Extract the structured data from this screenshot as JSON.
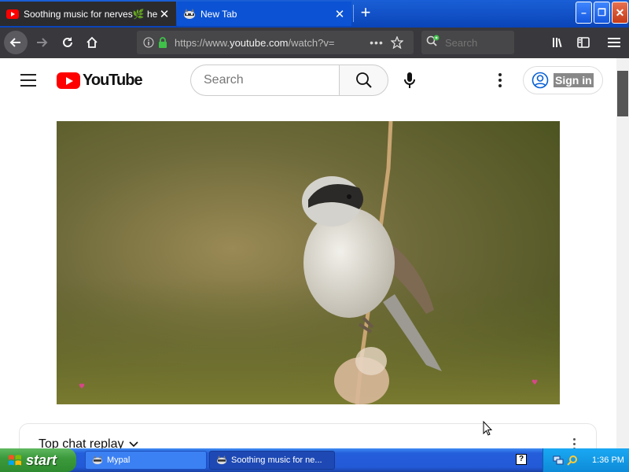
{
  "browser": {
    "tabs": [
      {
        "title": "Soothing music for nerves🌿 healing music for the heart and blood vessels, relaxation, music for soul",
        "favicon": "youtube-icon",
        "active": true
      },
      {
        "title": "New Tab",
        "favicon": "raccoon-icon",
        "active": false
      }
    ],
    "window_buttons": {
      "minimize": "–",
      "restore": "❐",
      "close": "✕"
    },
    "url_prefix": "https://www.",
    "url_domain": "youtube.com",
    "url_path": "/watch?v=",
    "search_placeholder": "Search"
  },
  "youtube": {
    "logo_text": "YouTube",
    "search_placeholder": "Search",
    "sign_in_label": "Sign in",
    "chat_title": "Top chat replay"
  },
  "taskbar": {
    "start_label": "start",
    "tasks": [
      {
        "label": "Mypal"
      },
      {
        "label": "Soothing music for ne..."
      }
    ],
    "help_label": "?",
    "clock": "1:36 PM"
  },
  "colors": {
    "xp_blue": "#245edb",
    "yt_red": "#ff0000",
    "firefox_dark": "#38383d"
  }
}
